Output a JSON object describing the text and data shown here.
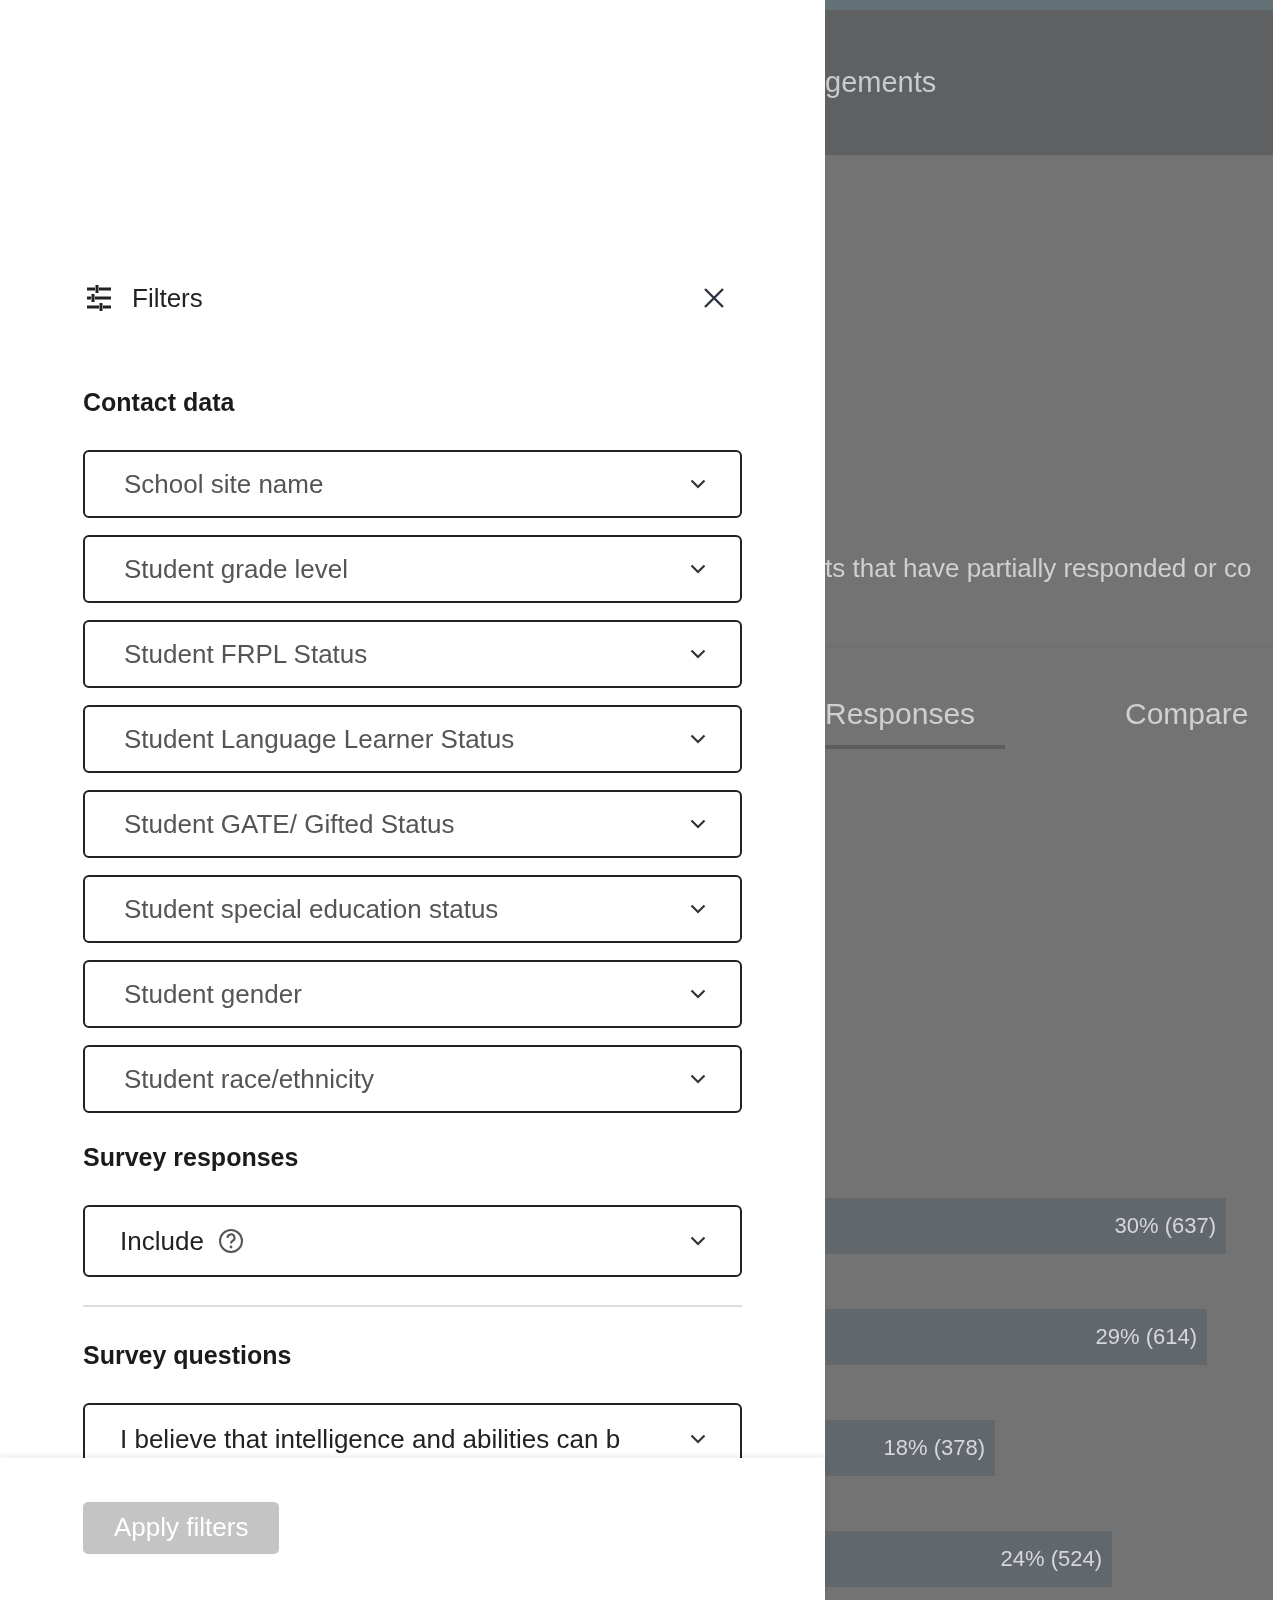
{
  "filters_panel": {
    "title": "Filters",
    "sections": [
      {
        "heading": "Contact data",
        "kind": "selects",
        "selects": [
          {
            "label": "School site name"
          },
          {
            "label": "Student grade level"
          },
          {
            "label": "Student FRPL Status"
          },
          {
            "label": "Student Language Learner Status"
          },
          {
            "label": "Student GATE/ Gifted Status"
          },
          {
            "label": "Student special education status"
          },
          {
            "label": "Student gender"
          },
          {
            "label": "Student race/ethnicity"
          }
        ]
      },
      {
        "heading": "Survey responses",
        "kind": "value",
        "selects": [
          {
            "label": "Include",
            "help": true
          }
        ]
      },
      {
        "heading": "Survey questions",
        "kind": "value",
        "selects": [
          {
            "label": "I believe that intelligence and abilities can b"
          }
        ]
      }
    ],
    "apply_button": {
      "label": "Apply filters",
      "disabled": true
    }
  },
  "background": {
    "header_text": "gements",
    "description": "ts that have partially responded or co",
    "tabs": [
      {
        "label": "Responses",
        "selected": true
      },
      {
        "label": "Compare",
        "selected": false
      }
    ],
    "bars": [
      {
        "label": "30% (637)"
      },
      {
        "label": "29% (614)"
      },
      {
        "label": "18% (378)"
      },
      {
        "label": "24% (524)"
      }
    ]
  }
}
